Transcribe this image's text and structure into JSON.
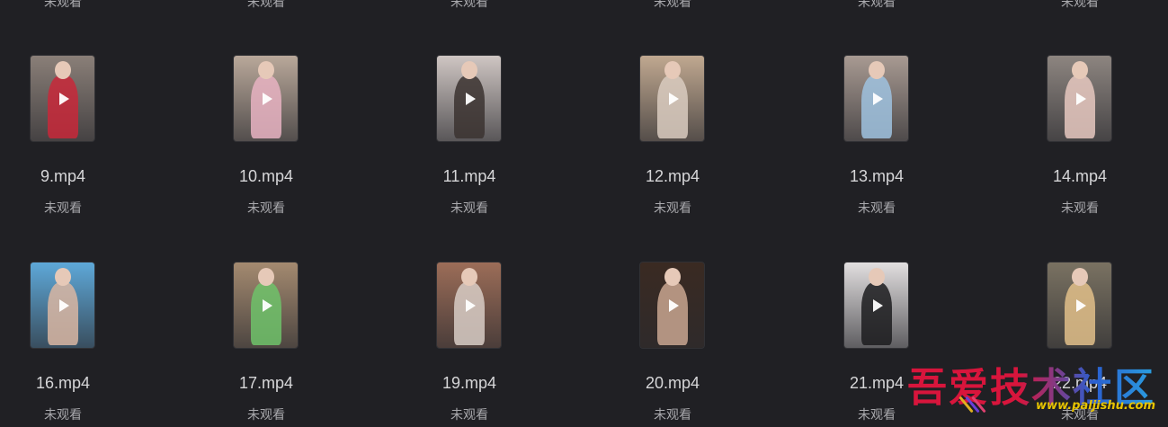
{
  "top_row": [
    {
      "status": "未观看"
    },
    {
      "status": "未观看"
    },
    {
      "status": "未观看"
    },
    {
      "status": "未观看"
    },
    {
      "status": "未观看"
    },
    {
      "status": "未观看"
    }
  ],
  "row1": [
    {
      "name": "9.mp4",
      "status": "未观看",
      "bg": "#8a7f78",
      "fig": "#c8283a"
    },
    {
      "name": "10.mp4",
      "status": "未观看",
      "bg": "#b9a89a",
      "fig": "#e7b3c2"
    },
    {
      "name": "11.mp4",
      "status": "未观看",
      "bg": "#cfc6c3",
      "fig": "#3b3230"
    },
    {
      "name": "12.mp4",
      "status": "未观看",
      "bg": "#c0a890",
      "fig": "#d9cbbf"
    },
    {
      "name": "13.mp4",
      "status": "未观看",
      "bg": "#a89a92",
      "fig": "#9fc2df"
    },
    {
      "name": "14.mp4",
      "status": "未观看",
      "bg": "#8d8580",
      "fig": "#e6c8c0"
    }
  ],
  "row2": [
    {
      "name": "16.mp4",
      "status": "未观看",
      "bg": "#5ea8d8",
      "fig": "#d9b6a2"
    },
    {
      "name": "17.mp4",
      "status": "未观看",
      "bg": "#a48a70",
      "fig": "#6fc26a"
    },
    {
      "name": "19.mp4",
      "status": "未观看",
      "bg": "#9c6d58",
      "fig": "#d8cdc6"
    },
    {
      "name": "20.mp4",
      "status": "未观看",
      "bg": "#3a2a22",
      "fig": "#c9a690"
    },
    {
      "name": "21.mp4",
      "status": "未观看",
      "bg": "#e2dfe0",
      "fig": "#1c1c1e"
    },
    {
      "name": "22.mp4",
      "status": "未观看",
      "bg": "#7a7262",
      "fig": "#e2c08a"
    }
  ],
  "watermark": {
    "title": "吾爱技术社区",
    "url": "www.paljishu.com"
  }
}
